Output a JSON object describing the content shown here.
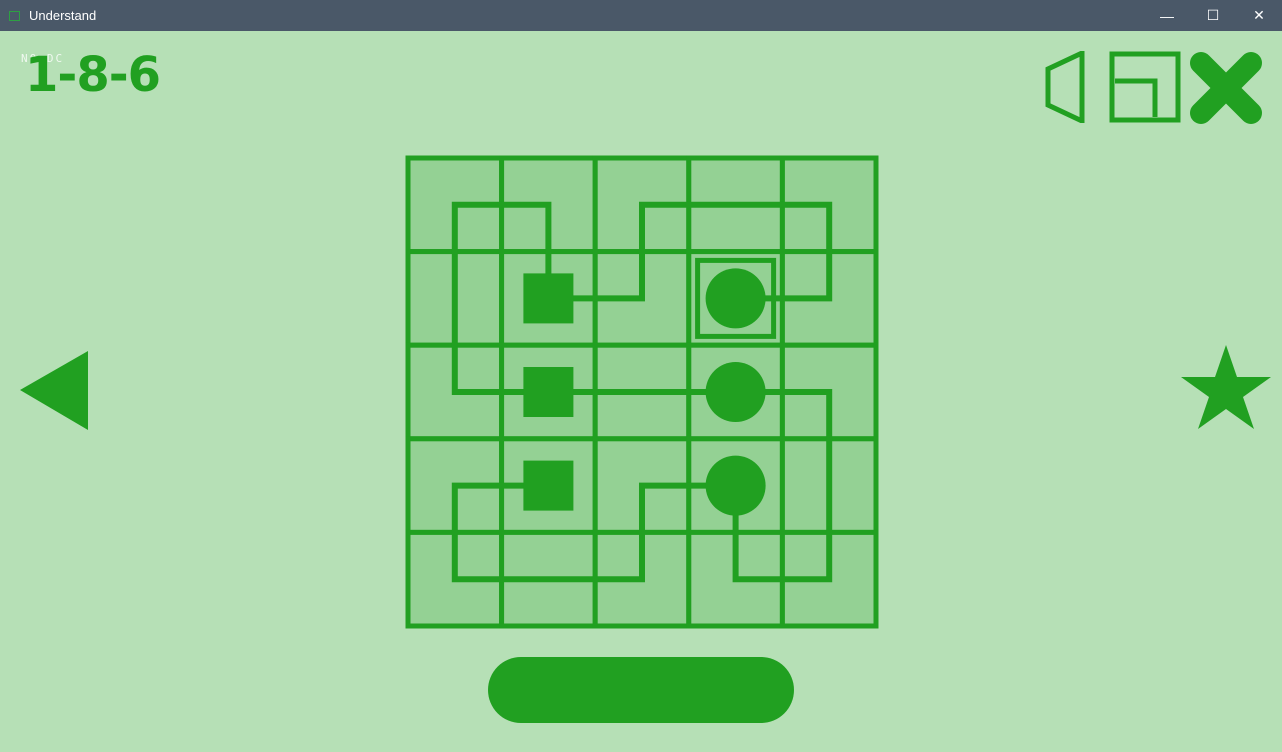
{
  "window": {
    "title": "Understand",
    "minimize_glyph": "—",
    "maximize_glyph": "☐",
    "close_glyph": "✕"
  },
  "hud": {
    "level_label": "1-8-6",
    "sublabel": "NO DC"
  },
  "icons": {
    "sound": "speaker-muted-icon",
    "window_mode": "window-mode-icon",
    "exit": "close-x-icon",
    "previous": "previous-arrow-icon",
    "favorite": "star-icon"
  },
  "colors": {
    "background": "#b6e0b6",
    "tile": "#94d194",
    "accent": "#21a021",
    "titlebar": "#4a5868"
  },
  "board": {
    "rows": 5,
    "cols": 5,
    "squares": [
      [
        1,
        1
      ],
      [
        2,
        1
      ],
      [
        3,
        1
      ]
    ],
    "circles": [
      [
        1,
        3
      ],
      [
        2,
        3
      ],
      [
        3,
        3
      ]
    ],
    "selected_cell": [
      1,
      3
    ],
    "paths": [
      [
        [
          1,
          1
        ],
        [
          0,
          1
        ],
        [
          0,
          0
        ],
        [
          2,
          0
        ],
        [
          2,
          1
        ]
      ],
      [
        [
          1,
          1
        ],
        [
          1,
          2
        ],
        [
          0,
          2
        ],
        [
          0,
          4
        ],
        [
          1,
          4
        ],
        [
          1,
          3
        ]
      ],
      [
        [
          2,
          1
        ],
        [
          2,
          3
        ]
      ],
      [
        [
          2,
          3
        ],
        [
          2,
          4
        ],
        [
          4,
          4
        ],
        [
          4,
          3
        ],
        [
          3,
          3
        ]
      ],
      [
        [
          3,
          1
        ],
        [
          3,
          0
        ],
        [
          4,
          0
        ],
        [
          4,
          2
        ],
        [
          3,
          2
        ],
        [
          3,
          3
        ]
      ]
    ]
  }
}
